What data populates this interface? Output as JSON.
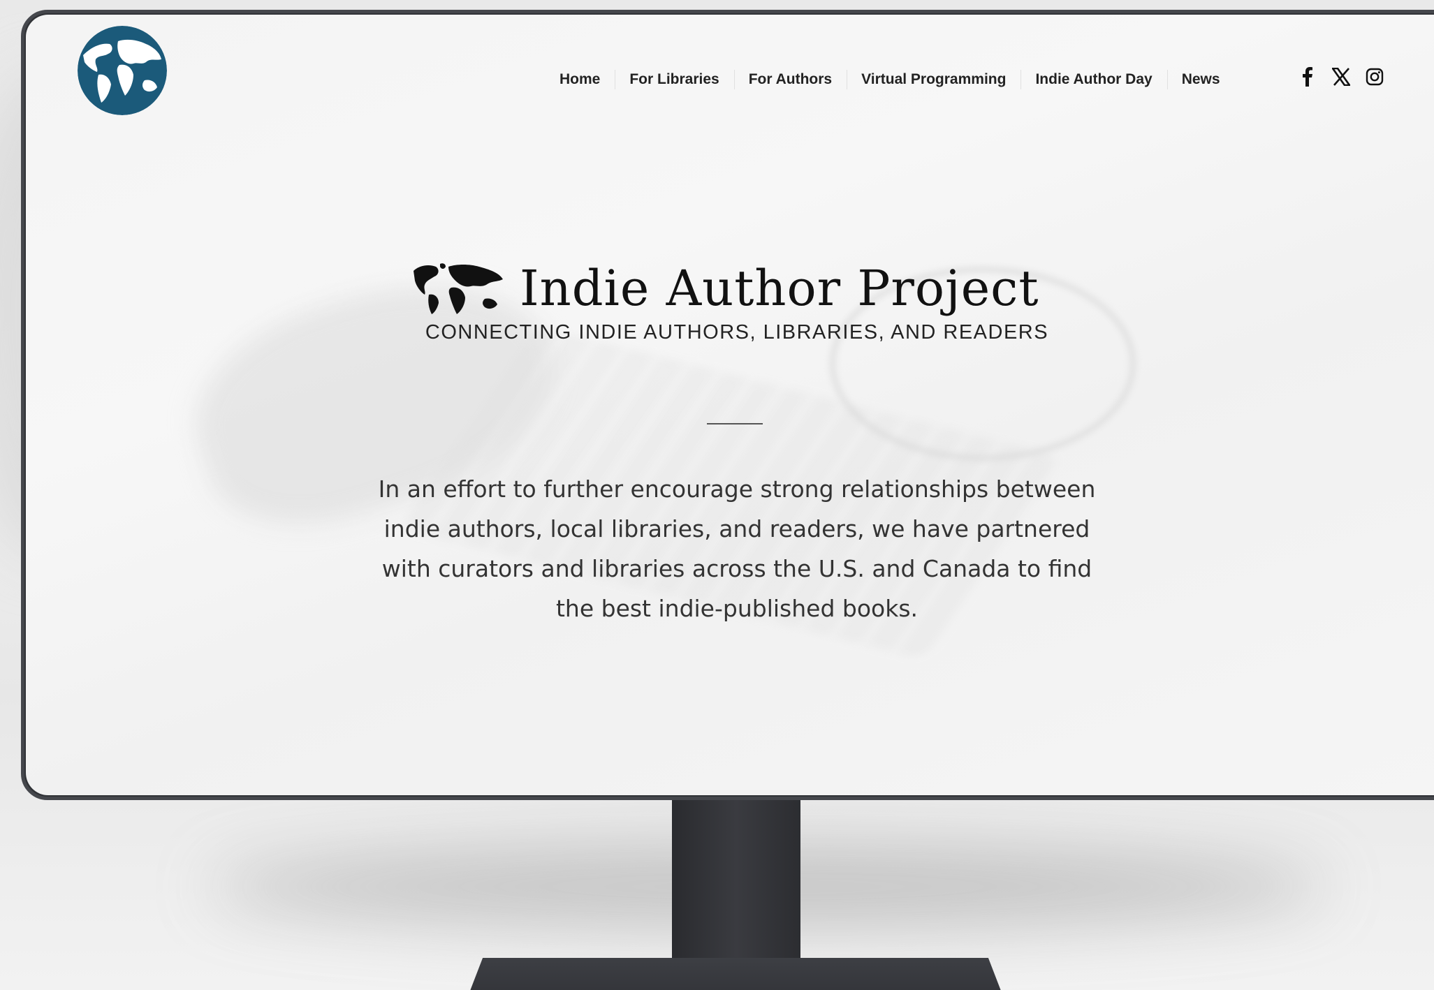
{
  "site": {
    "logo_icon": "globe-icon",
    "brand_title": "Indie Author Project",
    "tagline": "CONNECTING INDIE AUTHORS, LIBRARIES, AND READERS",
    "intro": "In an effort to further encourage strong relationships between indie authors, local libraries, and readers, we have partnered with curators and libraries across the U.S. and Canada to find the best indie-published books."
  },
  "nav": {
    "items": [
      {
        "label": "Home"
      },
      {
        "label": "For Libraries"
      },
      {
        "label": "For Authors"
      },
      {
        "label": "Virtual Programming"
      },
      {
        "label": "Indie Author Day"
      },
      {
        "label": "News"
      }
    ]
  },
  "social": {
    "icons": [
      "facebook-icon",
      "x-icon",
      "instagram-icon"
    ]
  },
  "colors": {
    "logo_blue": "#1b5a7a",
    "monitor_frame": "#45474c",
    "text_dark": "#222222"
  }
}
